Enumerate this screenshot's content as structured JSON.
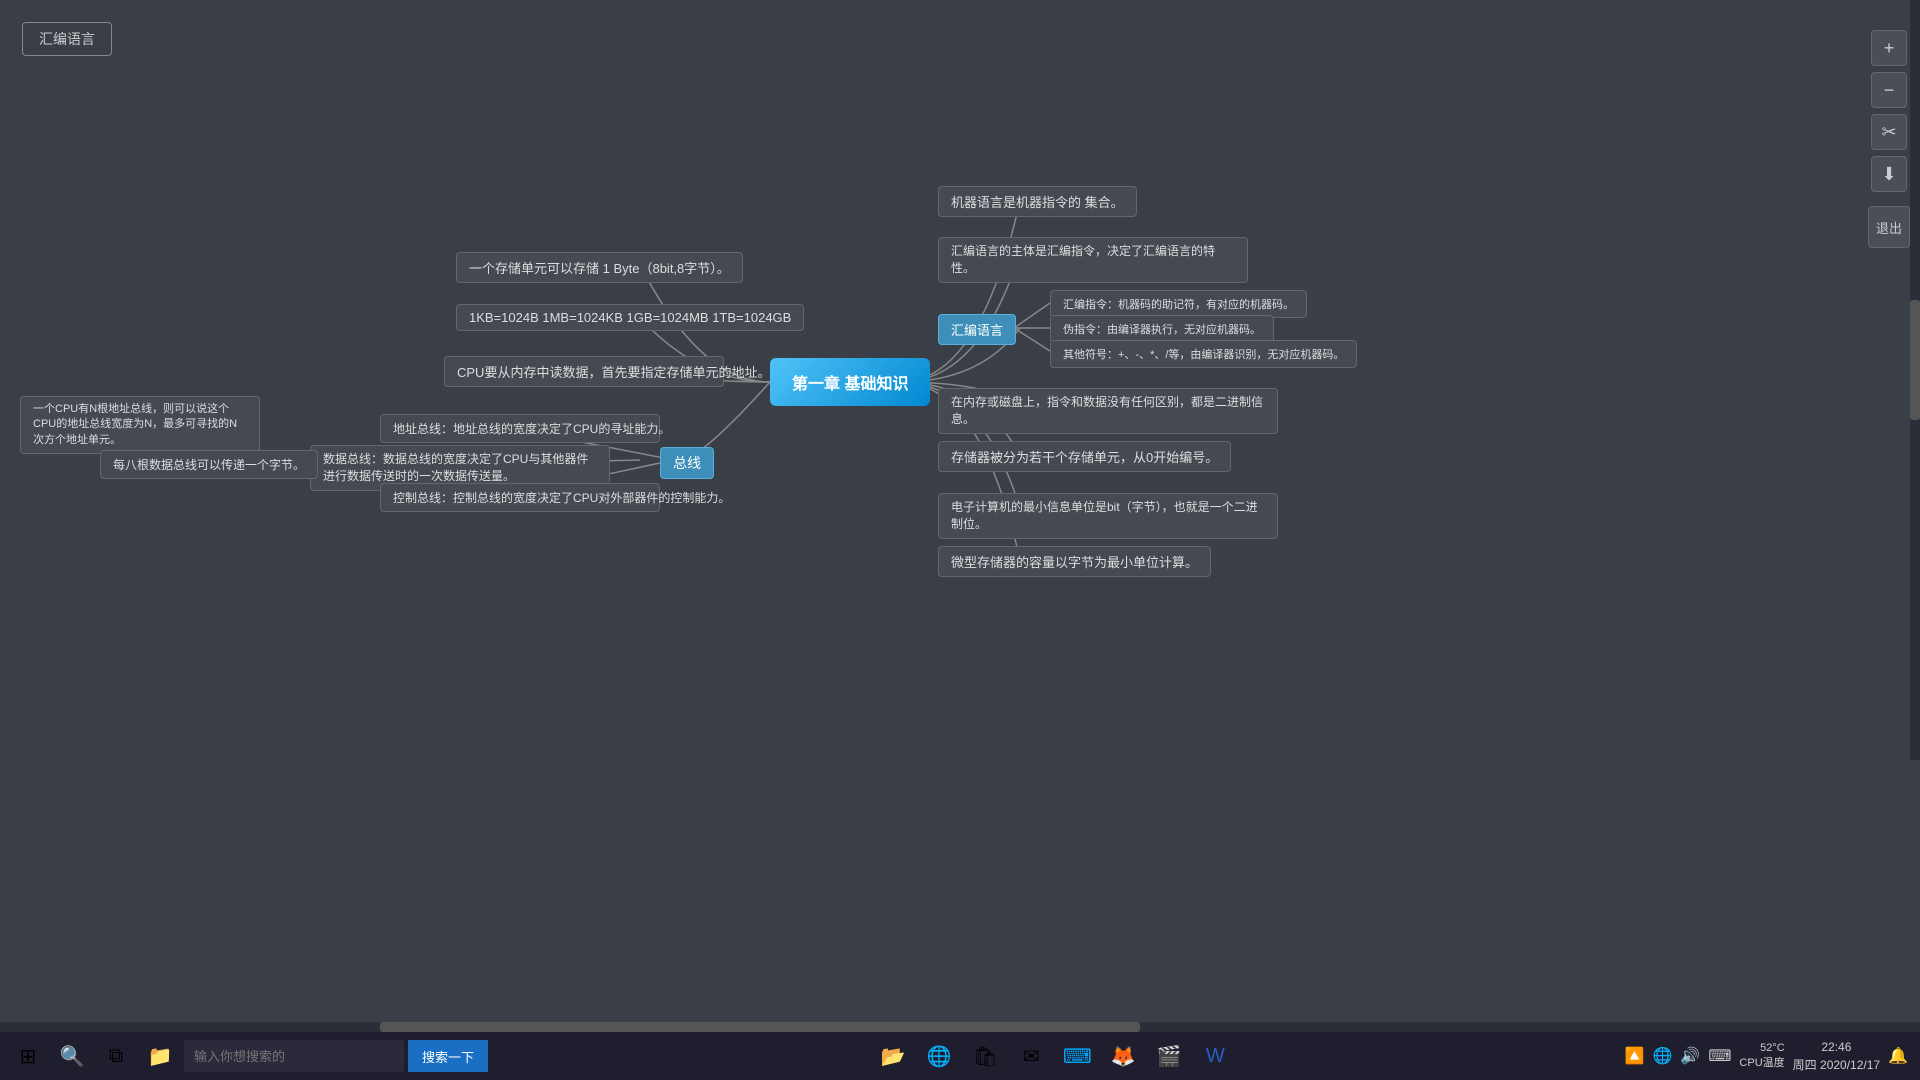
{
  "app": {
    "title": "汇编语言",
    "exit_label": "退出"
  },
  "toolbar": {
    "zoom_in": "+",
    "zoom_out": "−",
    "fit": "⊞"
  },
  "center_node": {
    "label": "第一章 基础知识"
  },
  "nodes": {
    "machine_lang_def": "机器语言是机器指令的 集合。",
    "assembly_subject": "汇编语言的主体是汇编指令，决定了汇编语言的特性。",
    "storage_unit": "一个存储单元可以存储 1 Byte（8bit,8字节）。",
    "kb_mb": "1KB=1024B 1MB=1024KB 1GB=1024MB 1TB=1024GB",
    "cpu_read": "CPU要从内存中读数据，首先要指定存储单元的地址。",
    "assembly_lang": "汇编语言",
    "assembly_instr": "汇编指令：机器码的助记符，有对应的机器码。",
    "pseudo_instr": "伪指令：由编译器执行，无对应机器码。",
    "other_symbols": "其他符号：+、-、*、/等，由编译器识别，无对应机器码。",
    "bus_label": "总线",
    "address_bus": "地址总线：地址总线的宽度决定了CPU的寻址能力。",
    "data_bus": "数据总线：数据总线的宽度决定了CPU与其他器件进行数据传送时的一次数据传送量。",
    "control_bus": "控制总线：控制总线的宽度决定了CPU对外部器件的控制能力。",
    "mem_disk_binary": "在内存或磁盘上，指令和数据没有任何区别，都是二进制信息。",
    "storage_from0": "存储器被分为若干个存储单元，从0开始编号。",
    "min_info": "电子计算机的最小信息单位是bit（字节），也就是一个二进制位。",
    "micro_storage": "微型存储器的容量以字节为最小单位计算。",
    "cpu_addr_width": "一个CPU有N根地址总线，则可以说这个CPU的地址总线宽度为N，最多可寻找的N次方个地址单元。",
    "data_bus_8bit": "每八根数据总线可以传递一个字节。"
  },
  "taskbar": {
    "search_placeholder": "输入你想搜索的",
    "search_btn": "搜索一下",
    "cpu_temp": "52°C",
    "cpu_label": "CPU温度",
    "time": "22:46",
    "weekday": "周四",
    "date": "2020/12/17"
  }
}
